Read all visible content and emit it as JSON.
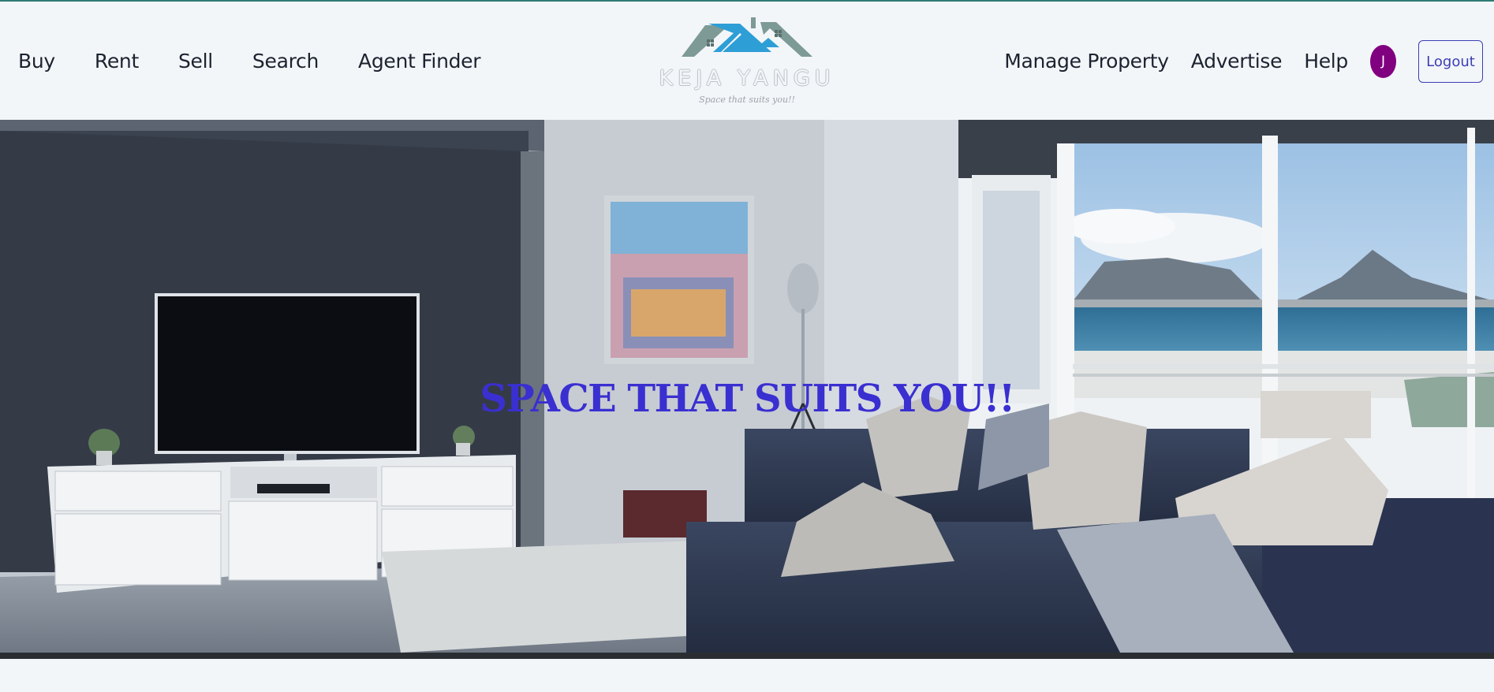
{
  "nav": {
    "left": [
      "Buy",
      "Rent",
      "Sell",
      "Search",
      "Agent Finder"
    ],
    "right": [
      "Manage Property",
      "Advertise",
      "Help"
    ],
    "avatar_initial": "J",
    "logout_label": "Logout"
  },
  "logo": {
    "name": "KEJA YANGU",
    "tagline": "Space that suits you!!"
  },
  "hero": {
    "headline": "SPACE THAT SUITS YOU!!"
  },
  "colors": {
    "accent": "#3a2fd0",
    "avatar": "#800080",
    "logout_border": "#3b3fb5",
    "roof_blue": "#2e9ed6",
    "roof_gray": "#7d9a96",
    "top_rule": "#2f7d74"
  }
}
